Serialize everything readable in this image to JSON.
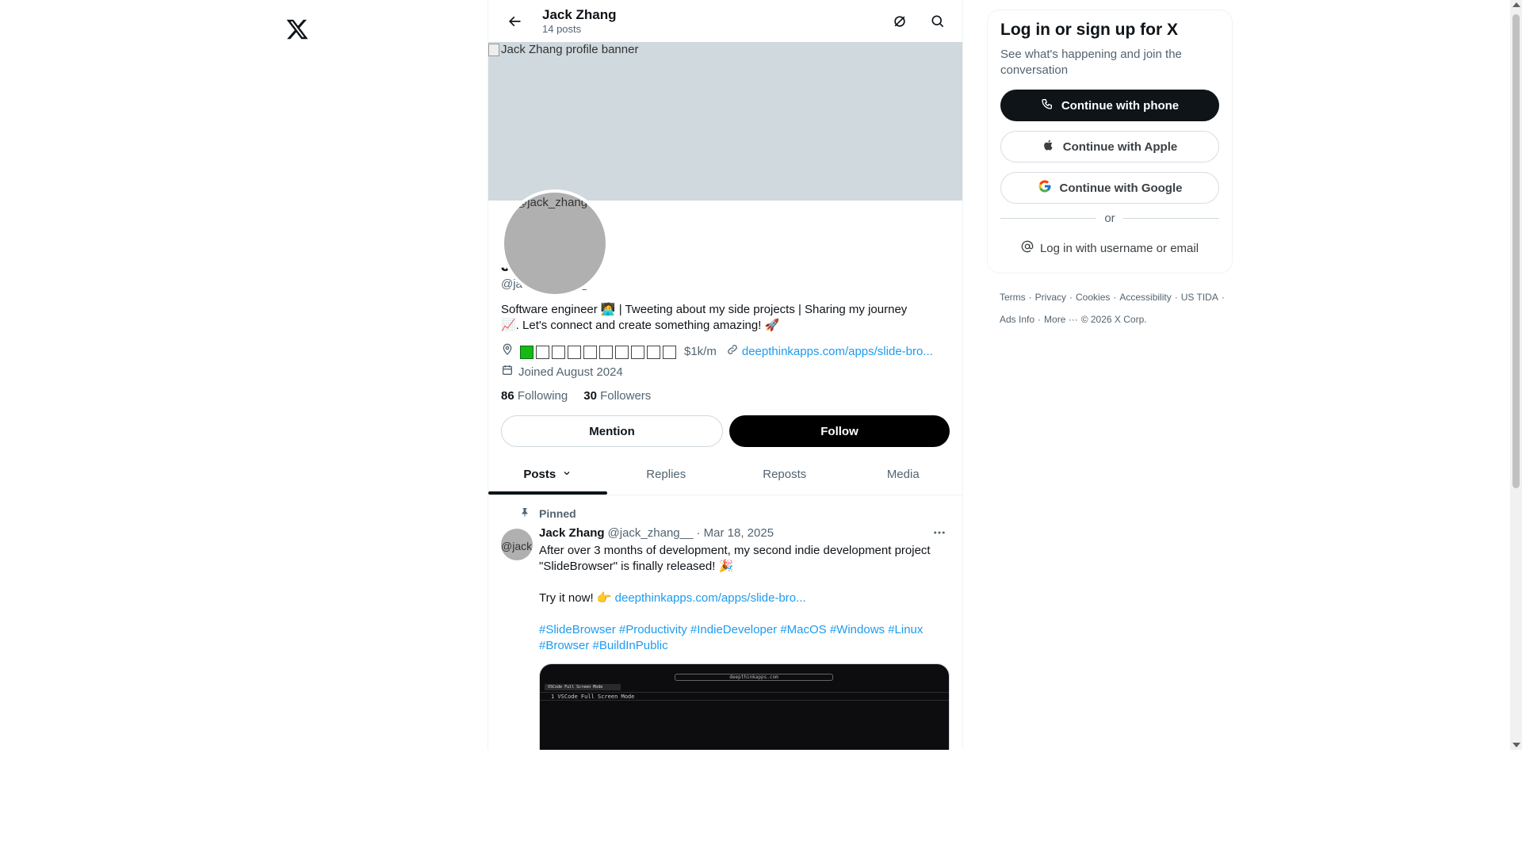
{
  "header": {
    "name": "Jack Zhang",
    "post_count": "14 posts"
  },
  "banner": {
    "alt": "Jack Zhang profile banner"
  },
  "avatar": {
    "alt": "@jack_zhang"
  },
  "profile": {
    "name": "Jack Zhang",
    "handle": "@jack_zhang__",
    "bio_line1": "Software engineer 🧑‍💻 |  Tweeting about my side projects |  Sharing my journey",
    "bio_line2": "📈. Let's connect and create something amazing! 🚀",
    "location_suffix": "$1k/m",
    "location_progress": {
      "filled": 1,
      "total": 10
    },
    "website": "deepthinkapps.com/apps/slide-bro...",
    "joined": "Joined August 2024",
    "following_count": "86",
    "following_label": "Following",
    "followers_count": "30",
    "followers_label": "Followers"
  },
  "actions": {
    "mention": "Mention",
    "follow": "Follow"
  },
  "tabs": [
    {
      "label": "Posts"
    },
    {
      "label": "Replies"
    },
    {
      "label": "Reposts"
    },
    {
      "label": "Media"
    }
  ],
  "post": {
    "pinned_label": "Pinned",
    "author": "Jack Zhang",
    "handle_date": "@jack_zhang__ · Mar 18, 2025",
    "avatar_alt": "@jack",
    "text_line1": "After over 3 months of development, my second indie development project",
    "text_line2": "\"SlideBrowser\" is finally released! 🎉",
    "try_text": "Try it now! 👉",
    "link": "deepthinkapps.com/apps/slide-bro...",
    "hashtags_line1": "#SlideBrowser #Productivity #IndieDeveloper #MacOS #Windows #Linux",
    "hashtags_line2": "#Browser #BuildInPublic",
    "media_url": "deepthinkapps.com",
    "media_tab": "VSCode Full Screen Mode",
    "media_line": "1   VSCode Full Screen Mode"
  },
  "signup": {
    "title": "Log in or sign up for X",
    "subtitle": "See what's happening and join the conversation",
    "phone": "Continue with phone",
    "apple": "Continue with Apple",
    "google": "Continue with Google",
    "or": "or",
    "login": "Log in with username or email"
  },
  "footer": {
    "row1": [
      "Terms",
      "·",
      "Privacy",
      "·",
      "Cookies",
      "·",
      "Accessibility",
      "·",
      "US TIDA",
      "·"
    ],
    "row2": [
      "Ads Info",
      "·",
      "More ···",
      "© 2026 X Corp."
    ]
  },
  "colors": {
    "accent": "#1d9bf0",
    "text": "#0f1419",
    "muted": "#536471",
    "banner": "#cfd9de"
  }
}
